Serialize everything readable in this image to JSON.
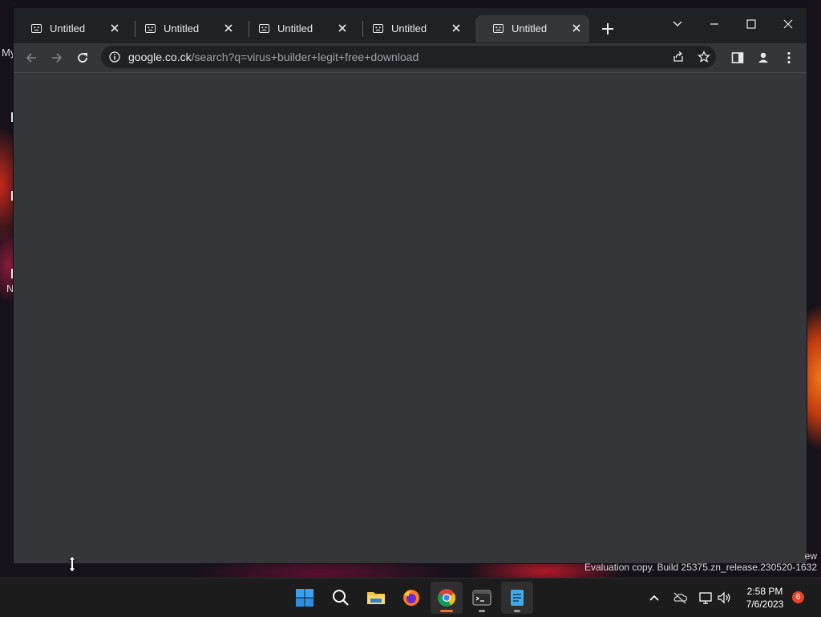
{
  "desktop": {
    "labels": [
      "My",
      "N"
    ],
    "watermark_line1": "ew",
    "watermark_line2": "Evaluation copy. Build 25375.zn_release.230520-1632"
  },
  "browser": {
    "tabs": [
      {
        "title": "Untitled",
        "icon": "sad-page-icon",
        "active": false
      },
      {
        "title": "Untitled",
        "icon": "sad-page-icon",
        "active": false
      },
      {
        "title": "Untitled",
        "icon": "sad-page-icon",
        "active": false
      },
      {
        "title": "Untitled",
        "icon": "sad-page-icon",
        "active": false
      },
      {
        "title": "Untitled",
        "icon": "sad-page-icon",
        "active": true
      }
    ],
    "address": {
      "host": "google.co.ck",
      "path": "/search?q=virus+builder+legit+free+download"
    }
  },
  "taskbar": {
    "apps": [
      "start",
      "search",
      "file-explorer",
      "firefox",
      "chrome",
      "terminal",
      "notepad"
    ],
    "clock_time": "2:58 PM",
    "clock_date": "7/6/2023",
    "notification_count": "6"
  },
  "colors": {
    "titlebar": "#202124",
    "toolbar": "#35363a",
    "omnibox": "#202124",
    "taskbar": "#1c1c1c"
  }
}
